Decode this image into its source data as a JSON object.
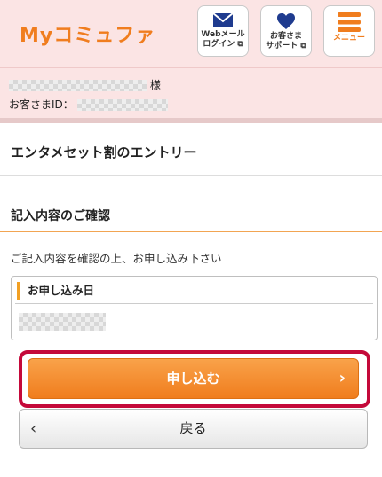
{
  "header": {
    "logo": "Myコミュファ",
    "webmail": {
      "line1": "Webメール",
      "line2": "ログイン"
    },
    "support": {
      "line1": "お客さま",
      "line2": "サポート"
    },
    "menu": "メニュー"
  },
  "user": {
    "name_suffix": "様",
    "id_label": "お客さまID："
  },
  "page_title": "エンタメセット割のエントリー",
  "section_title": "記入内容のご確認",
  "instruction": "ご記入内容を確認の上、お申し込み下さい",
  "fields": [
    {
      "label": "お申し込み日"
    }
  ],
  "buttons": {
    "submit": "申し込む",
    "back": "戻る"
  },
  "colors": {
    "accent": "#f07d1e",
    "header_bg": "#fbe4e4",
    "highlight": "#c4093a"
  }
}
